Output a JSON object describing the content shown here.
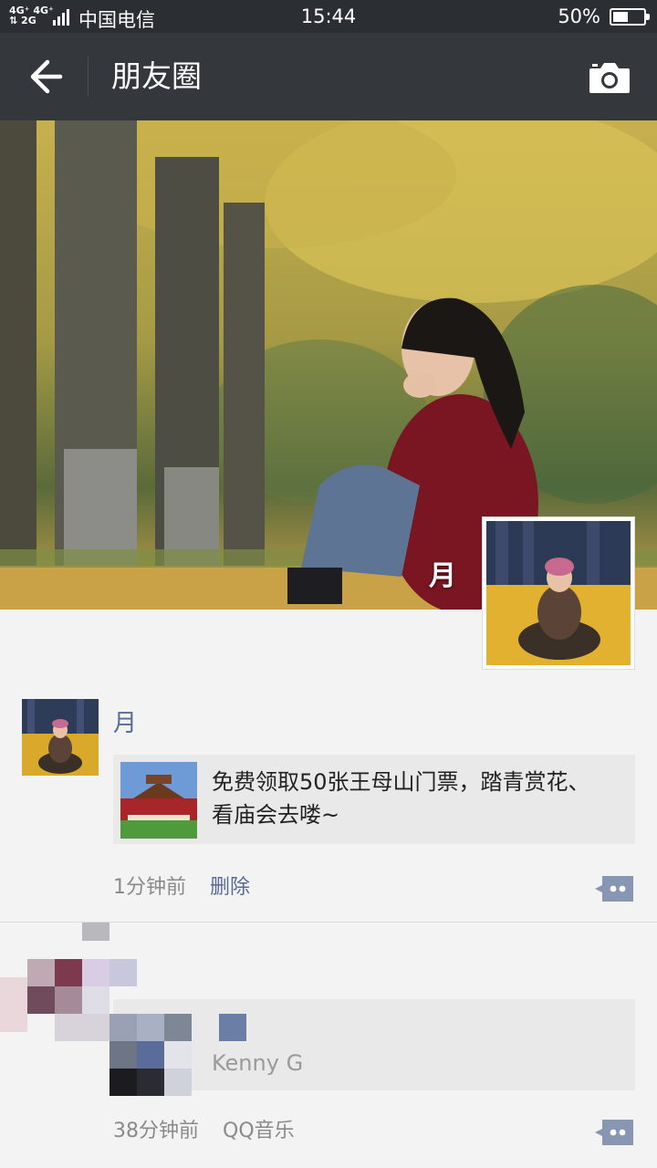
{
  "status_bar": {
    "network": "4G+ 4G⁺\n⇅ 2G",
    "carrier": "中国电信",
    "time": "15:44",
    "battery": "50%",
    "battery_level": 0.5
  },
  "nav": {
    "title": "朋友圈",
    "back_icon": "arrow-left-icon",
    "camera_icon": "camera-icon"
  },
  "cover": {
    "name": "月"
  },
  "posts": [
    {
      "name": "月",
      "share_text": "免费领取50张王母山门票，踏青赏花、看庙会去喽~",
      "time": "1分钟前",
      "action": "删除"
    },
    {
      "song": "Kenny G",
      "time": "38分钟前",
      "source": "QQ音乐"
    }
  ],
  "colors": {
    "link": "#576b95",
    "nav_bg": "#34373b",
    "status_bg": "#2b2f33"
  }
}
